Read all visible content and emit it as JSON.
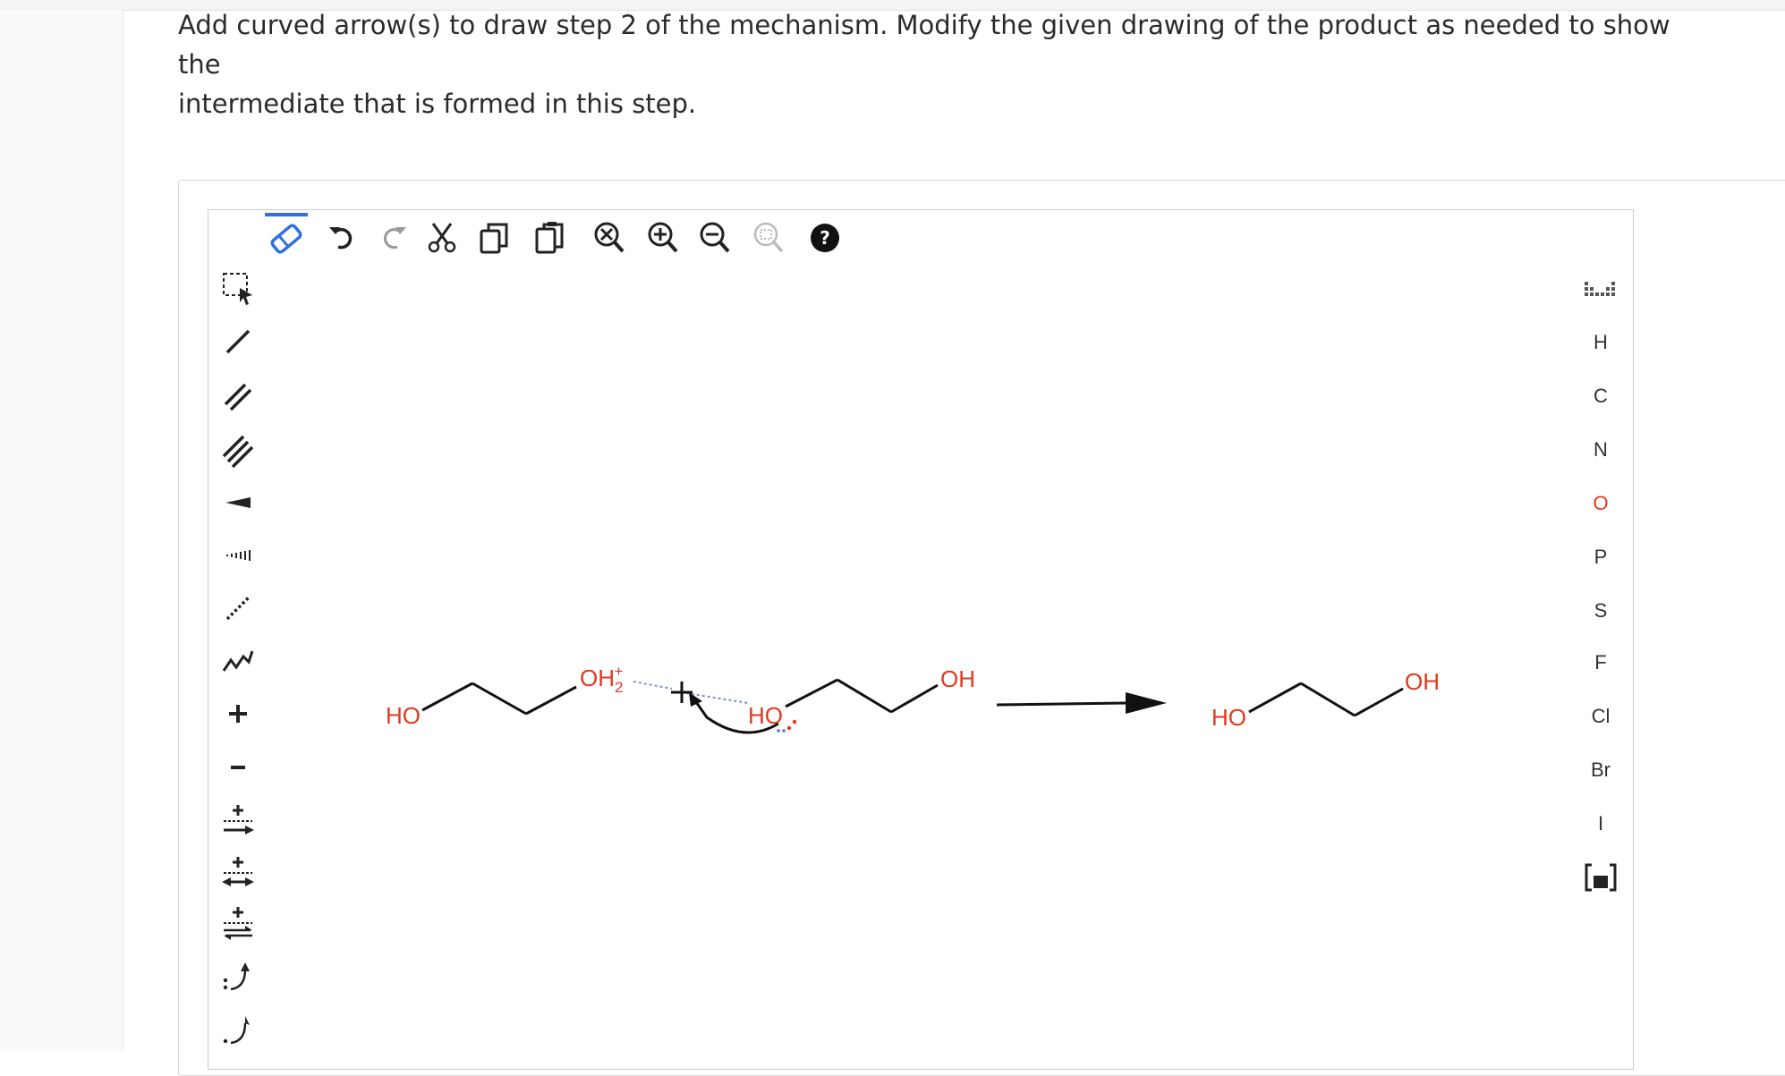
{
  "question": {
    "line1": "Add curved arrow(s) to draw step 2 of the mechanism. Modify the given drawing of the product as needed to show the",
    "line2": "intermediate that is formed in this step."
  },
  "toolbar": {
    "icons": [
      "eraser-icon",
      "undo-icon",
      "redo-icon",
      "cut-icon",
      "copy-icon",
      "paste-icon",
      "zoom-fit-icon",
      "zoom-in-icon",
      "zoom-out-icon",
      "zoom-reset-icon",
      "help-icon"
    ]
  },
  "left_tools": {
    "icons": [
      "select-icon",
      "single-bond-icon",
      "double-bond-icon",
      "triple-bond-icon",
      "wedge-bond-icon",
      "hash-bond-icon",
      "dashed-bond-icon",
      "chain-icon",
      "positive-charge-icon",
      "negative-charge-icon",
      "forward-arrow-icon",
      "resonance-arrow-icon",
      "equilibrium-arrow-icon",
      "electron-pair-arrow-icon",
      "single-electron-arrow-icon"
    ]
  },
  "elements": {
    "labels": [
      "H",
      "C",
      "N",
      "O",
      "P",
      "S",
      "F",
      "Cl",
      "Br",
      "I"
    ]
  },
  "molecules": {
    "reactant_left_ho": "HO",
    "oxonium_oh": "OH",
    "oxonium_sub": "2",
    "oxonium_charge": "+",
    "nucleophile_ho": "HO",
    "nucleophile_oh": "OH",
    "product_ho": "HO",
    "product_oh": "OH"
  },
  "colors": {
    "accent": "#2f6fe0",
    "oxygen": "#e03a20",
    "bond": "#111111"
  }
}
